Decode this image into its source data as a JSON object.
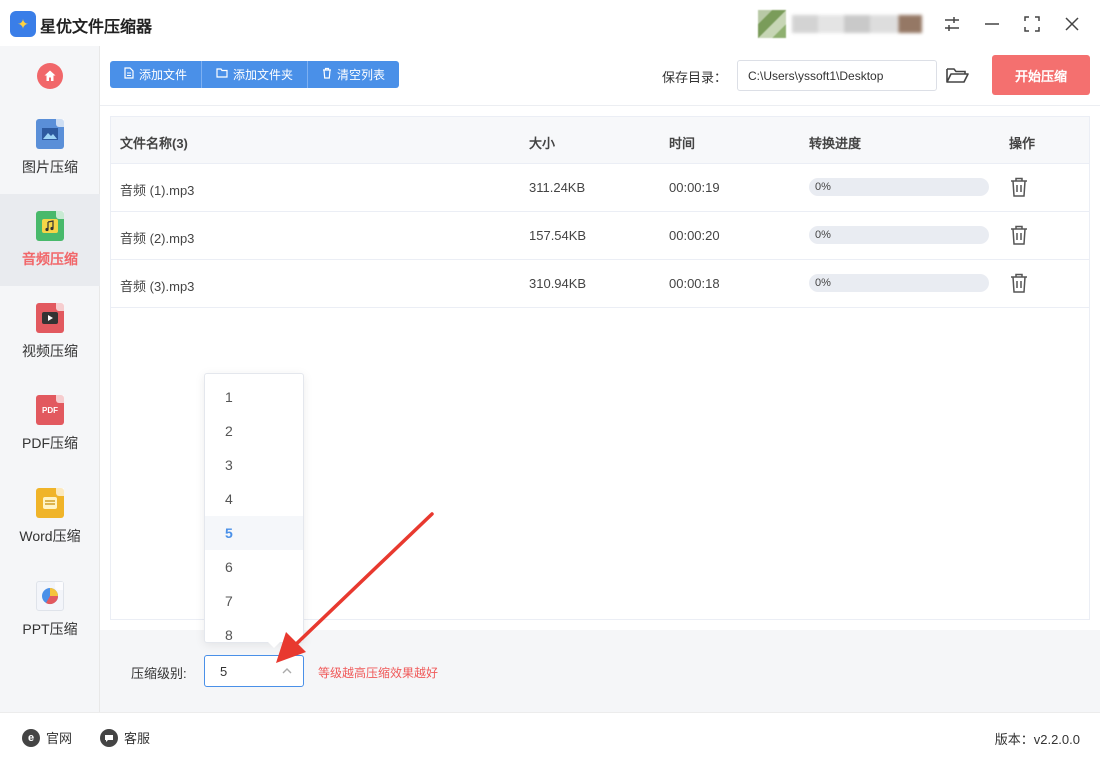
{
  "app": {
    "title": "星优文件压缩器",
    "logo_glyph": "✦",
    "user_name": "yssoft1"
  },
  "window": {
    "settings_icon": "sliders-icon",
    "minimize_icon": "minimize-icon",
    "maximize_icon": "maximize-icon",
    "close_icon": "close-icon"
  },
  "sidebar": {
    "home_icon": "home-icon",
    "items": [
      {
        "label": "图片压缩",
        "icon": "image-file-icon",
        "color": "#5a8fd8"
      },
      {
        "label": "音频压缩",
        "icon": "audio-file-icon",
        "color": "#48b96b",
        "active": true
      },
      {
        "label": "视频压缩",
        "icon": "video-file-icon",
        "color": "#e2595f"
      },
      {
        "label": "PDF压缩",
        "icon": "pdf-file-icon",
        "color": "#e2595f"
      },
      {
        "label": "Word压缩",
        "icon": "word-file-icon",
        "color": "#f0b429"
      },
      {
        "label": "PPT压缩",
        "icon": "ppt-file-icon",
        "color": "#e2595f"
      }
    ]
  },
  "toolbar": {
    "add_file": "添加文件",
    "add_folder": "添加文件夹",
    "clear_list": "清空列表",
    "save_dir_label": "保存目录：",
    "save_dir_value": "C:\\Users\\yssoft1\\Desktop",
    "start_button": "开始压缩"
  },
  "table": {
    "headers": {
      "name": "文件名称(3)",
      "size": "大小",
      "time": "时间",
      "progress": "转换进度",
      "action": "操作"
    },
    "rows": [
      {
        "name": "音频 (1).mp3",
        "size": "311.24KB",
        "time": "00:00:19",
        "progress_text": "0%",
        "progress": 0
      },
      {
        "name": "音频 (2).mp3",
        "size": "157.54KB",
        "time": "00:00:20",
        "progress_text": "0%",
        "progress": 0
      },
      {
        "name": "音频 (3).mp3",
        "size": "310.94KB",
        "time": "00:00:18",
        "progress_text": "0%",
        "progress": 0
      }
    ]
  },
  "settings": {
    "level_label": "压缩级别:",
    "level_value": "5",
    "level_hint": "等级越高压缩效果越好",
    "level_options": [
      "1",
      "2",
      "3",
      "4",
      "5",
      "6",
      "7",
      "8"
    ],
    "selected_option": "5"
  },
  "footer": {
    "website": "官网",
    "support": "客服",
    "version": "版本：v2.2.0.0"
  },
  "colors": {
    "accent": "#4a90e8",
    "start_button": "#f4706f",
    "hint": "#f05a5a",
    "annotation": "#e8392f"
  }
}
